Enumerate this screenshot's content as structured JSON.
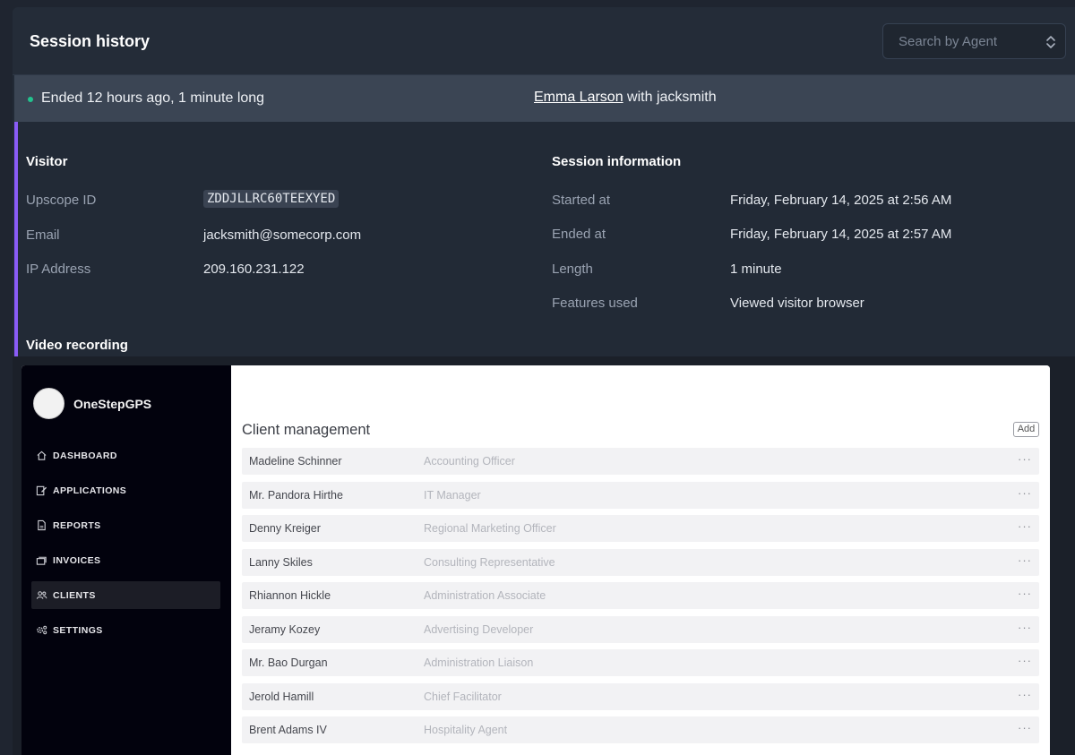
{
  "header": {
    "title": "Session history",
    "search_placeholder": "Search by Agent"
  },
  "status": {
    "ended": "Ended 12 hours ago, 1 minute long",
    "agent": "Emma Larson",
    "with_text": " with jacksmith",
    "dot_color": "#22c38e"
  },
  "visitor": {
    "heading": "Visitor",
    "fields": [
      {
        "label": "Upscope ID",
        "value": "ZDDJLLRC60TEEXYED"
      },
      {
        "label": "Email",
        "value": "jacksmith@somecorp.com"
      },
      {
        "label": "IP Address",
        "value": "209.160.231.122"
      }
    ]
  },
  "session": {
    "heading": "Session information",
    "fields": [
      {
        "label": "Started at",
        "value": "Friday, February 14, 2025 at 2:56 AM"
      },
      {
        "label": "Ended at",
        "value": "Friday, February 14, 2025 at 2:57 AM"
      },
      {
        "label": "Length",
        "value": "1 minute"
      },
      {
        "label": "Features used",
        "value": "Viewed visitor browser"
      }
    ]
  },
  "video": {
    "heading": "Video recording",
    "app": {
      "brand": "OneStepGPS",
      "nav": [
        {
          "label": "DASHBOARD",
          "icon": "home-icon"
        },
        {
          "label": "APPLICATIONS",
          "icon": "edit-icon"
        },
        {
          "label": "REPORTS",
          "icon": "document-icon"
        },
        {
          "label": "INVOICES",
          "icon": "stack-icon"
        },
        {
          "label": "CLIENTS",
          "icon": "users-icon",
          "active": true
        },
        {
          "label": "SETTINGS",
          "icon": "gears-icon"
        }
      ],
      "page_title": "Client management",
      "add_label": "Add",
      "clients": [
        {
          "name": "Madeline Schinner",
          "role": "Accounting Officer"
        },
        {
          "name": "Mr. Pandora Hirthe",
          "role": "IT Manager"
        },
        {
          "name": "Denny Kreiger",
          "role": "Regional Marketing Officer"
        },
        {
          "name": "Lanny Skiles",
          "role": "Consulting Representative"
        },
        {
          "name": "Rhiannon Hickle",
          "role": "Administration Associate"
        },
        {
          "name": "Jeramy Kozey",
          "role": "Advertising Developer"
        },
        {
          "name": "Mr. Bao Durgan",
          "role": "Administration Liaison"
        },
        {
          "name": "Jerold Hamill",
          "role": "Chief Facilitator"
        },
        {
          "name": "Brent Adams IV",
          "role": "Hospitality Agent"
        }
      ]
    }
  }
}
